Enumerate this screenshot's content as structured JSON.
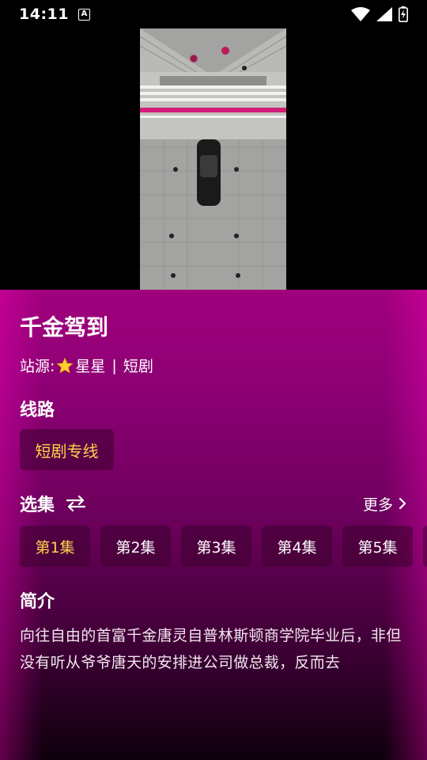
{
  "status_bar": {
    "time": "14:11",
    "notification_badge": "A"
  },
  "video": {
    "description_icon": "video-frame"
  },
  "drama": {
    "title": "千金驾到",
    "source_prefix": "站源:",
    "source_name": "星星",
    "source_sep": "|",
    "source_category": "短剧"
  },
  "routes": {
    "label": "线路",
    "items": [
      {
        "label": "短剧专线",
        "active": true
      }
    ]
  },
  "episodes": {
    "label": "选集",
    "more_label": "更多",
    "items": [
      {
        "label": "第1集",
        "active": true
      },
      {
        "label": "第2集",
        "active": false
      },
      {
        "label": "第3集",
        "active": false
      },
      {
        "label": "第4集",
        "active": false
      },
      {
        "label": "第5集",
        "active": false
      }
    ]
  },
  "synopsis": {
    "label": "简介",
    "text": "向往自由的首富千金唐灵自普林斯顿商学院毕业后，非但没有听从爷爷唐天的安排进公司做总裁，反而去"
  },
  "colors": {
    "accent": "#ffd24a",
    "bg_top": "#a0007c",
    "bg_bottom": "#0e000c"
  }
}
